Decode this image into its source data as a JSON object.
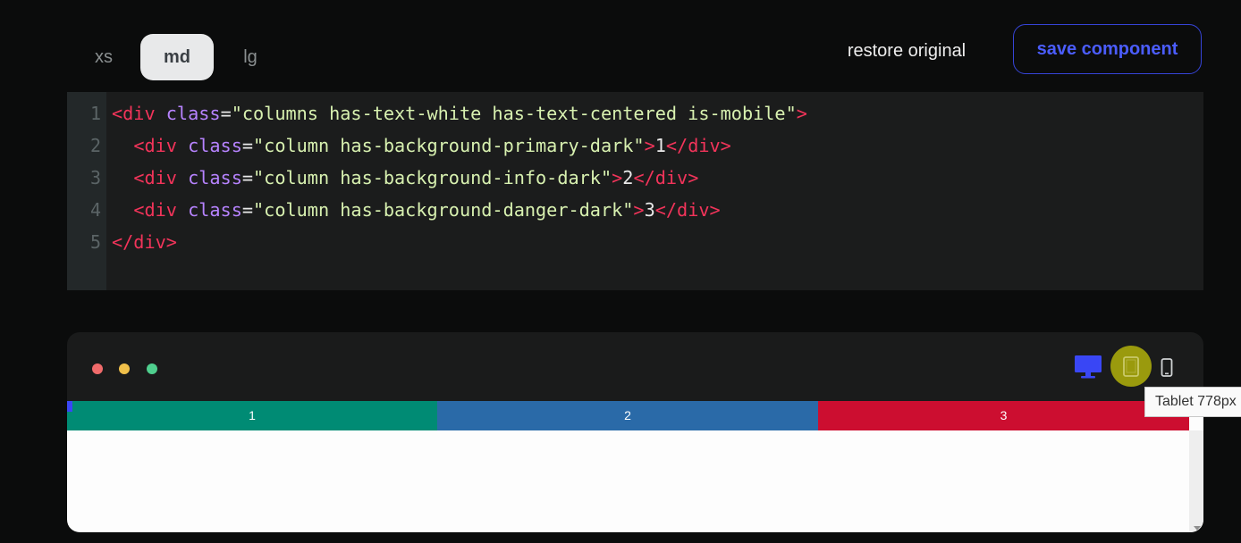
{
  "size_tabs": [
    {
      "label": "xs",
      "active": false
    },
    {
      "label": "md",
      "active": true
    },
    {
      "label": "lg",
      "active": false
    }
  ],
  "actions": {
    "restore_label": "restore original",
    "save_label": "save component"
  },
  "editor": {
    "line_numbers": [
      "1",
      "2",
      "3",
      "4",
      "5"
    ],
    "lines": [
      [
        {
          "c": "t",
          "v": "<div "
        },
        {
          "c": "a",
          "v": "class"
        },
        {
          "c": "p",
          "v": "="
        },
        {
          "c": "s",
          "v": "\"columns has-text-white has-text-centered is-mobile\""
        },
        {
          "c": "t",
          "v": ">"
        }
      ],
      [
        {
          "c": "p",
          "v": "  "
        },
        {
          "c": "t",
          "v": "<div "
        },
        {
          "c": "a",
          "v": "class"
        },
        {
          "c": "p",
          "v": "="
        },
        {
          "c": "s",
          "v": "\"column has-background-primary-dark\""
        },
        {
          "c": "t",
          "v": ">"
        },
        {
          "c": "p",
          "v": "1"
        },
        {
          "c": "t",
          "v": "</div>"
        }
      ],
      [
        {
          "c": "p",
          "v": "  "
        },
        {
          "c": "t",
          "v": "<div "
        },
        {
          "c": "a",
          "v": "class"
        },
        {
          "c": "p",
          "v": "="
        },
        {
          "c": "s",
          "v": "\"column has-background-info-dark\""
        },
        {
          "c": "t",
          "v": ">"
        },
        {
          "c": "p",
          "v": "2"
        },
        {
          "c": "t",
          "v": "</div>"
        }
      ],
      [
        {
          "c": "p",
          "v": "  "
        },
        {
          "c": "t",
          "v": "<div "
        },
        {
          "c": "a",
          "v": "class"
        },
        {
          "c": "p",
          "v": "="
        },
        {
          "c": "s",
          "v": "\"column has-background-danger-dark\""
        },
        {
          "c": "t",
          "v": ">"
        },
        {
          "c": "p",
          "v": "3"
        },
        {
          "c": "t",
          "v": "</div>"
        }
      ],
      [
        {
          "c": "t",
          "v": "</div>"
        }
      ]
    ]
  },
  "preview": {
    "window_dots": [
      "#f06b6b",
      "#f0c04a",
      "#4fcf8e"
    ],
    "columns": [
      {
        "label": "1",
        "color": "#008b74"
      },
      {
        "label": "2",
        "color": "#2a6aa8"
      },
      {
        "label": "3",
        "color": "#cc0e30"
      }
    ],
    "devices": [
      {
        "name": "desktop-icon",
        "active_color": "#3a47f5"
      },
      {
        "name": "tablet-icon",
        "highlight": "#9a9a0d"
      },
      {
        "name": "mobile-icon",
        "color": "#cfd2d4"
      }
    ],
    "tooltip": "Tablet 778px"
  }
}
